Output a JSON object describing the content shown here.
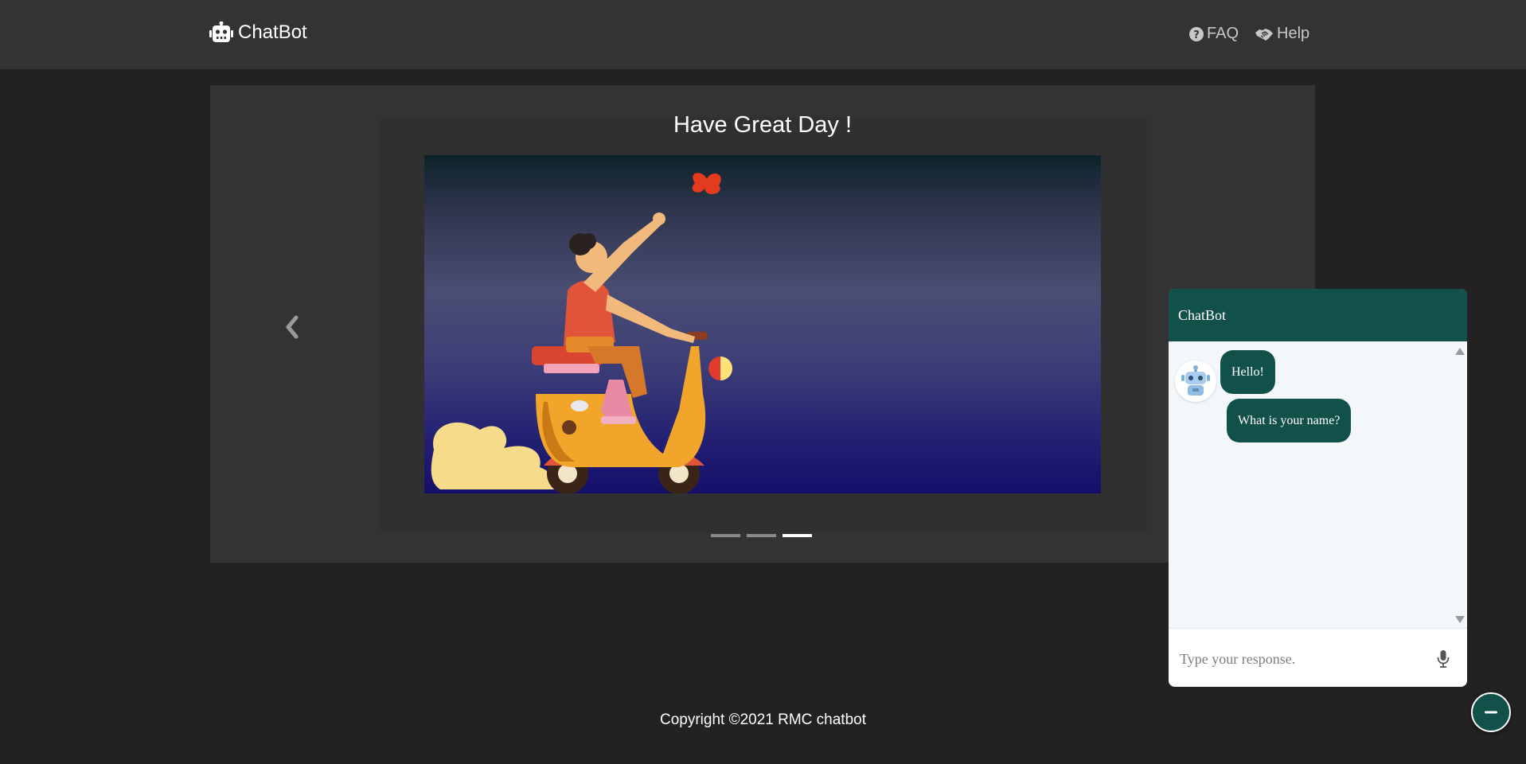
{
  "navbar": {
    "brand_label": "ChatBot",
    "brand_icon": "robot-icon",
    "links": [
      {
        "label": "FAQ",
        "icon": "question-circle-icon"
      },
      {
        "label": "Help",
        "icon": "handshake-icon"
      }
    ]
  },
  "carousel": {
    "slide_title": "Have Great Day !",
    "slide_image": "illustration-woman-on-scooter",
    "prev_icon": "chevron-left-icon",
    "indicators": [
      {
        "active": false
      },
      {
        "active": false
      },
      {
        "active": true
      }
    ]
  },
  "footer": {
    "copyright": "Copyright ©2021 RMC chatbot"
  },
  "chat_widget": {
    "title": "ChatBot",
    "avatar_icon": "robot-avatar-icon",
    "messages": [
      {
        "sender": "bot",
        "text": "Hello!"
      },
      {
        "sender": "bot",
        "text": "What is your name?"
      }
    ],
    "input": {
      "value": "",
      "placeholder": "Type your response."
    },
    "mic_icon": "microphone-icon",
    "minimize_icon": "minus-icon"
  },
  "colors": {
    "page_background": "#222222",
    "navbar_background": "#333333",
    "chat_accent": "#12504a",
    "chat_body": "#f3f7fa"
  }
}
